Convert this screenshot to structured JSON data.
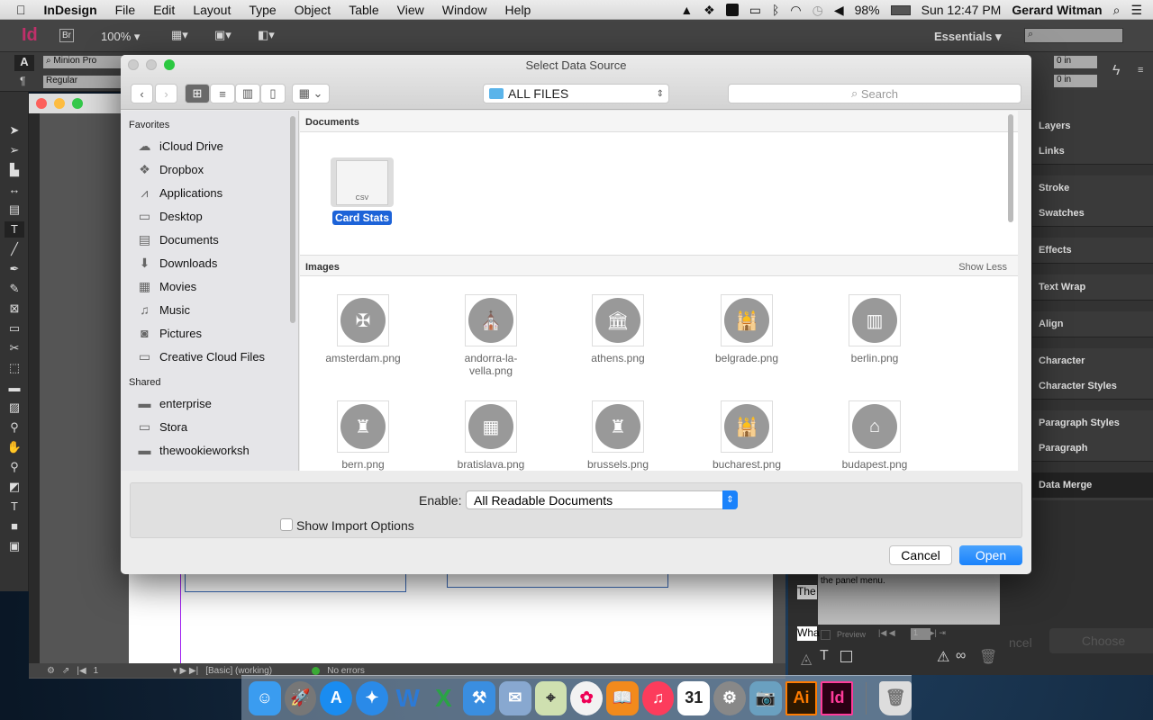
{
  "menubar": {
    "app": "InDesign",
    "items": [
      "File",
      "Edit",
      "Layout",
      "Type",
      "Object",
      "Table",
      "View",
      "Window",
      "Help"
    ],
    "battery": "98%",
    "clock": "Sun 12:47 PM",
    "user": "Gerard Witman"
  },
  "appbar": {
    "logo": "Id",
    "bridge": "Br",
    "zoom": "100%",
    "workspace": "Essentials"
  },
  "control": {
    "font": "Minion Pro",
    "style": "Regular",
    "offset1": "0 in",
    "offset2": "0 in"
  },
  "panels": [
    "Layers",
    "Links",
    "Stroke",
    "Swatches",
    "Effects",
    "Text Wrap",
    "Align",
    "Character",
    "Character Styles",
    "Paragraph Styles",
    "Paragraph",
    "Data Merge"
  ],
  "datamerge": {
    "hint": "the panel menu.",
    "preview": "Preview",
    "page": "1",
    "row1": "The",
    "row2": "Wha",
    "cancel": "ncel",
    "choose": "Choose"
  },
  "status": {
    "page": "1",
    "profile": "[Basic] (working)",
    "errors": "No errors"
  },
  "dialog": {
    "title": "Select Data Source",
    "location": "ALL FILES",
    "search_placeholder": "Search",
    "sidebar": {
      "favorites_label": "Favorites",
      "favorites": [
        {
          "label": "iCloud Drive",
          "icon": "cloud-icon"
        },
        {
          "label": "Dropbox",
          "icon": "dropbox-icon"
        },
        {
          "label": "Applications",
          "icon": "applications-icon"
        },
        {
          "label": "Desktop",
          "icon": "desktop-icon"
        },
        {
          "label": "Documents",
          "icon": "documents-icon"
        },
        {
          "label": "Downloads",
          "icon": "downloads-icon"
        },
        {
          "label": "Movies",
          "icon": "movies-icon"
        },
        {
          "label": "Music",
          "icon": "music-icon"
        },
        {
          "label": "Pictures",
          "icon": "pictures-icon"
        },
        {
          "label": "Creative Cloud Files",
          "icon": "folder-icon"
        }
      ],
      "shared_label": "Shared",
      "shared": [
        {
          "label": "enterprise"
        },
        {
          "label": "Stora"
        },
        {
          "label": "thewookieworksh"
        }
      ]
    },
    "documents_label": "Documents",
    "document_file": {
      "name": "Card Stats",
      "type": "CSV"
    },
    "images_label": "Images",
    "show_less": "Show Less",
    "images": [
      "amsterdam.png",
      "andorra-la-vella.png",
      "athens.png",
      "belgrade.png",
      "berlin.png",
      "bern.png",
      "bratislava.png",
      "brussels.png",
      "bucharest.png",
      "budapest.png"
    ],
    "enable_label": "Enable:",
    "enable_value": "All Readable Documents",
    "show_import_options": "Show Import Options",
    "show_import_checked": false,
    "cancel": "Cancel",
    "open": "Open"
  },
  "colors": {
    "accent": "#1a82fb",
    "selection": "#1d63d8",
    "indesign": "#d4006e"
  }
}
